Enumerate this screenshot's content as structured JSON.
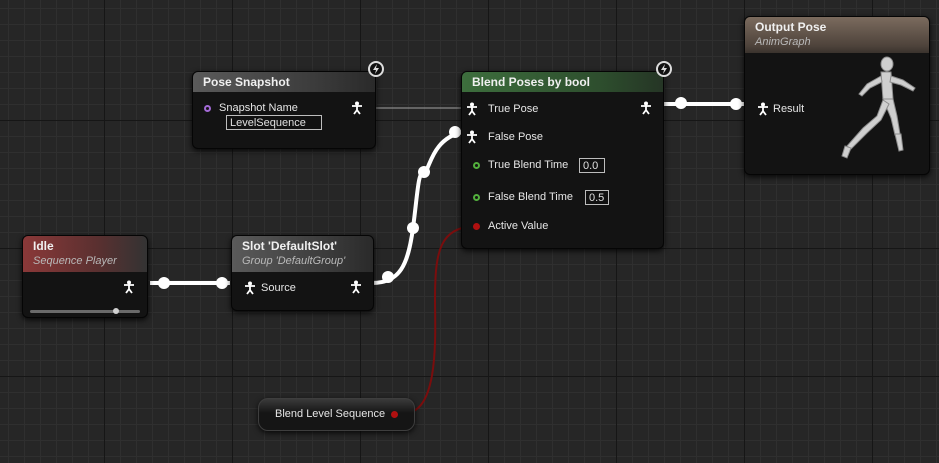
{
  "colors": {
    "exec_wire": "#ffffff",
    "bool_wire": "#7a0d0d",
    "pose_header": "#5a5a5a",
    "idle_header": "#8a3838",
    "blend_header": "#3d6e3d",
    "output_header": "#7b6b5e"
  },
  "pose_snapshot": {
    "title": "Pose Snapshot",
    "snapshot_name_label": "Snapshot Name",
    "snapshot_name_value": "LevelSequence",
    "icons": [
      "bolt-icon",
      "pose-pin-icon",
      "name-pin-icon"
    ]
  },
  "blend_poses": {
    "title": "Blend Poses by bool",
    "true_pose_label": "True Pose",
    "false_pose_label": "False Pose",
    "true_blend_time_label": "True Blend Time",
    "true_blend_time_value": "0.0",
    "false_blend_time_label": "False Blend Time",
    "false_blend_time_value": "0.5",
    "active_value_label": "Active Value"
  },
  "output_pose": {
    "title": "Output Pose",
    "subtitle": "AnimGraph",
    "result_label": "Result",
    "icons": [
      "mannequin-running-icon"
    ]
  },
  "idle": {
    "title": "Idle",
    "subtitle": "Sequence Player",
    "play_position": 0.78
  },
  "slot": {
    "title": "Slot 'DefaultSlot'",
    "subtitle": "Group 'DefaultGroup'",
    "source_label": "Source"
  },
  "variable": {
    "label": "Blend Level Sequence"
  }
}
